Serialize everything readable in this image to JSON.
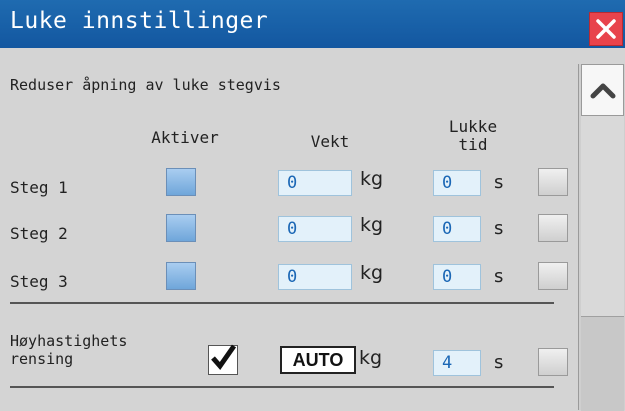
{
  "window": {
    "title": "Luke innstillinger"
  },
  "heading": "Reduser åpning av luke stegvis",
  "columns": {
    "aktiver": "Aktiver",
    "vekt": "Vekt",
    "lukke_tid_line1": "Lukke",
    "lukke_tid_line2": "tid"
  },
  "rows": [
    {
      "label": "Steg 1",
      "vekt": "0",
      "vekt_unit": "kg",
      "tid": "0",
      "tid_unit": "s"
    },
    {
      "label": "Steg 2",
      "vekt": "0",
      "vekt_unit": "kg",
      "tid": "0",
      "tid_unit": "s"
    },
    {
      "label": "Steg 3",
      "vekt": "0",
      "vekt_unit": "kg",
      "tid": "0",
      "tid_unit": "s"
    }
  ],
  "hoyhastighet": {
    "label_line1": "Høyhastighets",
    "label_line2": "rensing",
    "checked": true,
    "vekt": "AUTO",
    "vekt_unit": "kg",
    "tid": "4",
    "tid_unit": "s"
  },
  "icons": {
    "close": "close-icon",
    "scroll_up": "chevron-up-icon",
    "check": "checkmark-icon"
  },
  "colors": {
    "title_bar": "#1357a0",
    "close": "#e8434c",
    "input_bg": "#e3f1fa",
    "input_text": "#1b67b5"
  }
}
